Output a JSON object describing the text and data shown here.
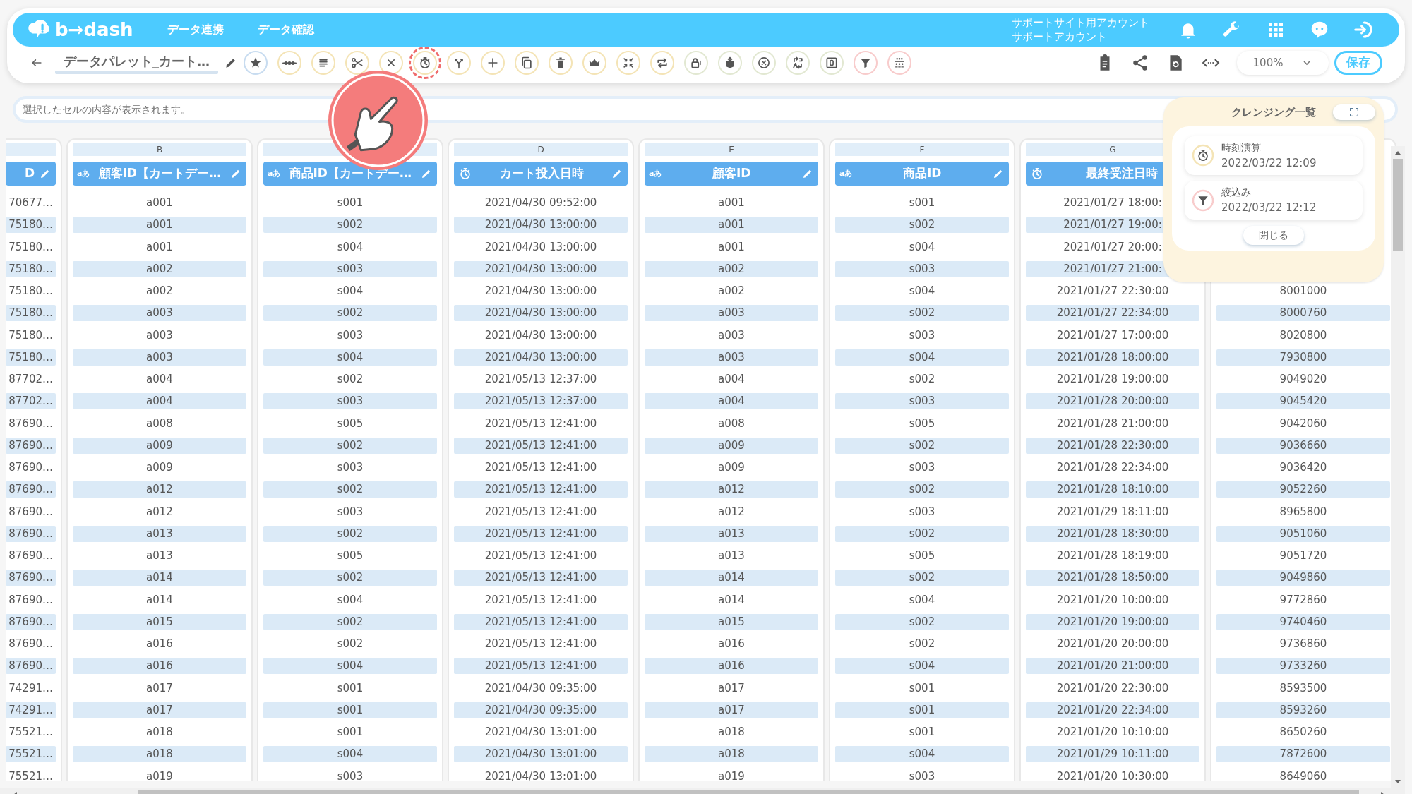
{
  "header": {
    "logo": "b→dash",
    "nav": [
      "データ連携",
      "データ確認"
    ],
    "account": [
      "サポートサイト用アカウント",
      "サポートアカウント"
    ]
  },
  "toolbar": {
    "title": "データパレット_カート…",
    "tools": [
      {
        "color": "#c8dcf0",
        "highlighted": false
      },
      {
        "color": "#f4e4b6",
        "highlighted": false
      },
      {
        "color": "#f4e4b6",
        "highlighted": false
      },
      {
        "color": "#f4e4b6",
        "highlighted": false
      },
      {
        "color": "#f4e4b6",
        "highlighted": false
      },
      {
        "color": "#f4e4b6",
        "highlighted": true
      },
      {
        "color": "#f4e4b6",
        "highlighted": false
      },
      {
        "color": "#f4e4b6",
        "highlighted": false
      },
      {
        "color": "#f4e4b6",
        "highlighted": false
      },
      {
        "color": "#f4e4b6",
        "highlighted": false
      },
      {
        "color": "#f4e4b6",
        "highlighted": false
      },
      {
        "color": "#f4e4b6",
        "highlighted": false
      },
      {
        "color": "#f4e4b6",
        "highlighted": false
      },
      {
        "color": "#e2e8d2",
        "highlighted": false
      },
      {
        "color": "#e2e8d2",
        "highlighted": false
      },
      {
        "color": "#e2e8d2",
        "highlighted": false
      },
      {
        "color": "#e2e8d2",
        "highlighted": false
      },
      {
        "color": "#e2e8d2",
        "highlighted": false
      },
      {
        "color": "#f8cccc",
        "highlighted": false
      },
      {
        "color": "#f8cccc",
        "highlighted": false
      }
    ],
    "zoom": "100%",
    "save": "保存"
  },
  "cell_field": {
    "placeholder": "選択したセルの内容が表示されます。"
  },
  "columns": [
    {
      "header": {
        "title": "D",
        "edit_icon": true
      },
      "cells": [
        "70677…",
        "75180…",
        "75180…",
        "75180…",
        "75180…",
        "75180…",
        "75180…",
        "75180…",
        "87702…",
        "87702…",
        "87690…",
        "87690…",
        "87690…",
        "87690…",
        "87690…",
        "87690…",
        "87690…",
        "87690…",
        "87690…",
        "87690…",
        "87690…",
        "87690…",
        "74291…",
        "74291…",
        "75521…",
        "75521…",
        "75521…"
      ]
    },
    {
      "letter": "B",
      "header": {
        "kind": "text",
        "type_label": "aあ",
        "title": "顧客ID【カートデー…",
        "edit_icon": true
      },
      "cells": [
        "a001",
        "a001",
        "a001",
        "a002",
        "a002",
        "a003",
        "a003",
        "a003",
        "a004",
        "a004",
        "a008",
        "a009",
        "a009",
        "a012",
        "a012",
        "a013",
        "a013",
        "a014",
        "a014",
        "a015",
        "a016",
        "a016",
        "a017",
        "a017",
        "a018",
        "a018",
        "a019"
      ]
    },
    {
      "header": {
        "kind": "text",
        "type_label": "aあ",
        "title": "商品ID【カートデー…",
        "edit_icon": true
      },
      "cells": [
        "s001",
        "s002",
        "s004",
        "s003",
        "s004",
        "s002",
        "s003",
        "s004",
        "s002",
        "s003",
        "s005",
        "s002",
        "s003",
        "s002",
        "s003",
        "s002",
        "s005",
        "s002",
        "s004",
        "s002",
        "s002",
        "s004",
        "s001",
        "s001",
        "s001",
        "s004",
        "s003"
      ]
    },
    {
      "letter": "D",
      "header": {
        "kind": "time",
        "title": "カート投入日時",
        "edit_icon": true
      },
      "cells": [
        "2021/04/30 09:52:00",
        "2021/04/30 13:00:00",
        "2021/04/30 13:00:00",
        "2021/04/30 13:00:00",
        "2021/04/30 13:00:00",
        "2021/04/30 13:00:00",
        "2021/04/30 13:00:00",
        "2021/04/30 13:00:00",
        "2021/05/13 12:37:00",
        "2021/05/13 12:37:00",
        "2021/05/13 12:41:00",
        "2021/05/13 12:41:00",
        "2021/05/13 12:41:00",
        "2021/05/13 12:41:00",
        "2021/05/13 12:41:00",
        "2021/05/13 12:41:00",
        "2021/05/13 12:41:00",
        "2021/05/13 12:41:00",
        "2021/05/13 12:41:00",
        "2021/05/13 12:41:00",
        "2021/05/13 12:41:00",
        "2021/05/13 12:41:00",
        "2021/04/30 09:35:00",
        "2021/04/30 09:35:00",
        "2021/04/30 13:01:00",
        "2021/04/30 13:01:00",
        "2021/04/30 13:01:00"
      ]
    },
    {
      "letter": "E",
      "header": {
        "kind": "text",
        "type_label": "aあ",
        "title": "顧客ID",
        "edit_icon": true
      },
      "cells": [
        "a001",
        "a001",
        "a001",
        "a002",
        "a002",
        "a003",
        "a003",
        "a003",
        "a004",
        "a004",
        "a008",
        "a009",
        "a009",
        "a012",
        "a012",
        "a013",
        "a013",
        "a014",
        "a014",
        "a015",
        "a016",
        "a016",
        "a017",
        "a017",
        "a018",
        "a018",
        "a019"
      ]
    },
    {
      "letter": "F",
      "header": {
        "kind": "text",
        "type_label": "aあ",
        "title": "商品ID",
        "edit_icon": true
      },
      "cells": [
        "s001",
        "s002",
        "s004",
        "s003",
        "s004",
        "s002",
        "s003",
        "s004",
        "s002",
        "s003",
        "s005",
        "s002",
        "s003",
        "s002",
        "s003",
        "s002",
        "s005",
        "s002",
        "s004",
        "s002",
        "s002",
        "s004",
        "s001",
        "s001",
        "s001",
        "s004",
        "s003"
      ]
    },
    {
      "letter": "G",
      "header": {
        "kind": "time",
        "title": "最終受注日時",
        "edit_icon": false
      },
      "cells": [
        "2021/01/27 18:00:",
        "2021/01/27 19:00:",
        "2021/01/27 20:00:",
        "2021/01/27 21:00:",
        "2021/01/27 22:30:00",
        "2021/01/27 22:34:00",
        "2021/01/27 17:00:00",
        "2021/01/28 18:00:00",
        "2021/01/28 19:00:00",
        "2021/01/28 20:00:00",
        "2021/01/28 21:00:00",
        "2021/01/28 22:30:00",
        "2021/01/28 22:34:00",
        "2021/01/28 18:10:00",
        "2021/01/29 18:11:00",
        "2021/01/28 18:30:00",
        "2021/01/28 18:19:00",
        "2021/01/28 18:50:00",
        "2021/01/20 10:00:00",
        "2021/01/20 19:00:00",
        "2021/01/20 20:00:00",
        "2021/01/20 21:00:00",
        "2021/01/20 22:30:00",
        "2021/01/20 22:34:00",
        "2021/01/20 10:10:00",
        "2021/01/29 10:11:00",
        "2021/01/20 10:30:00"
      ]
    },
    {
      "cells": [
        "8001000",
        "8000760",
        "8020800",
        "7930800",
        "9049020",
        "9045420",
        "9042060",
        "9036660",
        "9036420",
        "9052260",
        "8965800",
        "9051060",
        "9051720",
        "9049860",
        "9772860",
        "9740460",
        "9736860",
        "9733260",
        "8593500",
        "8593260",
        "8650260",
        "7872600",
        "8649060"
      ]
    }
  ],
  "cleansing_panel": {
    "title": "クレンジング一覧",
    "items": [
      {
        "kind": "time",
        "name": "時刻演算",
        "date": "2022/03/22 12:09"
      },
      {
        "kind": "filter",
        "name": "絞込み",
        "date": "2022/03/22 12:12"
      }
    ],
    "close": "閉じる"
  }
}
